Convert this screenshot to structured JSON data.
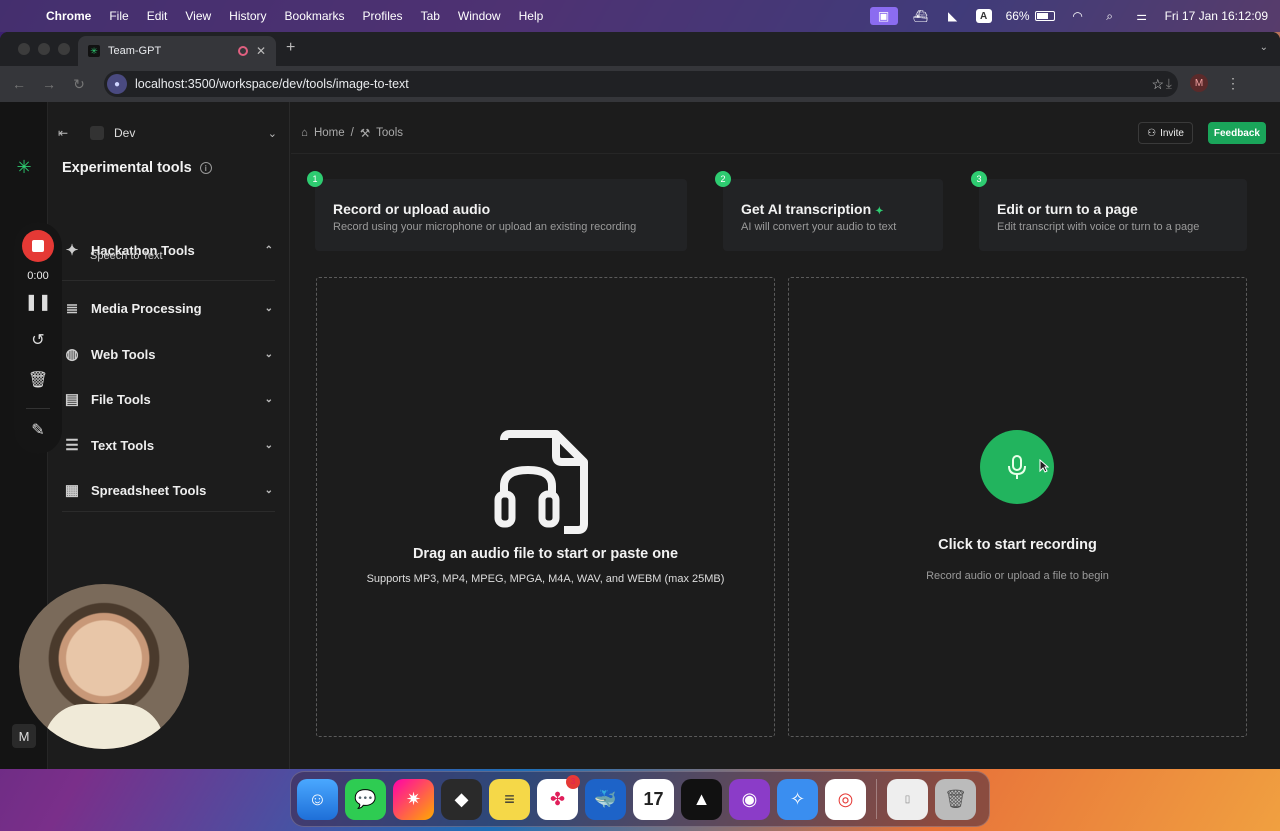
{
  "menubar": {
    "app_name": "Chrome",
    "items": [
      "File",
      "Edit",
      "View",
      "History",
      "Bookmarks",
      "Profiles",
      "Tab",
      "Window",
      "Help"
    ],
    "battery": "66%",
    "keyboard_indicator": "A",
    "datetime": "Fri 17 Jan  16:12:09"
  },
  "browser": {
    "tab_title": "Team-GPT",
    "url": "localhost:3500/workspace/dev/tools/image-to-text",
    "profile_initial": "M"
  },
  "workspace": {
    "name": "Dev"
  },
  "sidebar": {
    "title": "Experimental tools",
    "categories": [
      {
        "label": "Hackathon Tools",
        "icon": "sparkles-icon",
        "expanded": true
      },
      {
        "label": "Media Processing",
        "icon": "media-icon",
        "expanded": false
      },
      {
        "label": "Web Tools",
        "icon": "globe-icon",
        "expanded": false
      },
      {
        "label": "File Tools",
        "icon": "file-icon",
        "expanded": false
      },
      {
        "label": "Text Tools",
        "icon": "text-icon",
        "expanded": false
      },
      {
        "label": "Spreadsheet Tools",
        "icon": "table-icon",
        "expanded": false
      }
    ],
    "hackathon_sub": "Speech to Text"
  },
  "recorder": {
    "time": "0:00"
  },
  "user_initial": "M",
  "breadcrumb": {
    "home": "Home",
    "separator": "/",
    "tools": "Tools"
  },
  "header": {
    "invite": "Invite",
    "feedback": "Feedback"
  },
  "steps": [
    {
      "num": "1",
      "title": "Record or upload audio",
      "desc": "Record using your microphone or upload an existing recording"
    },
    {
      "num": "2",
      "title": "Get AI transcription",
      "desc": "AI will convert your audio to text"
    },
    {
      "num": "3",
      "title": "Edit or turn to a page",
      "desc": "Edit transcript with voice or turn to a page"
    }
  ],
  "upload": {
    "title": "Drag an audio file to start or paste one",
    "subtitle": "Supports MP3, MP4, MPEG, MPGA, M4A, WAV, and WEBM (max 25MB)"
  },
  "record": {
    "title": "Click to start recording",
    "subtitle": "Record audio or upload a file to begin"
  },
  "dock": {
    "slack_badge": "3",
    "calendar_day": "17"
  },
  "colors": {
    "accent": "#22b45e",
    "stop": "#e53935",
    "background": "#1c1c1c"
  }
}
